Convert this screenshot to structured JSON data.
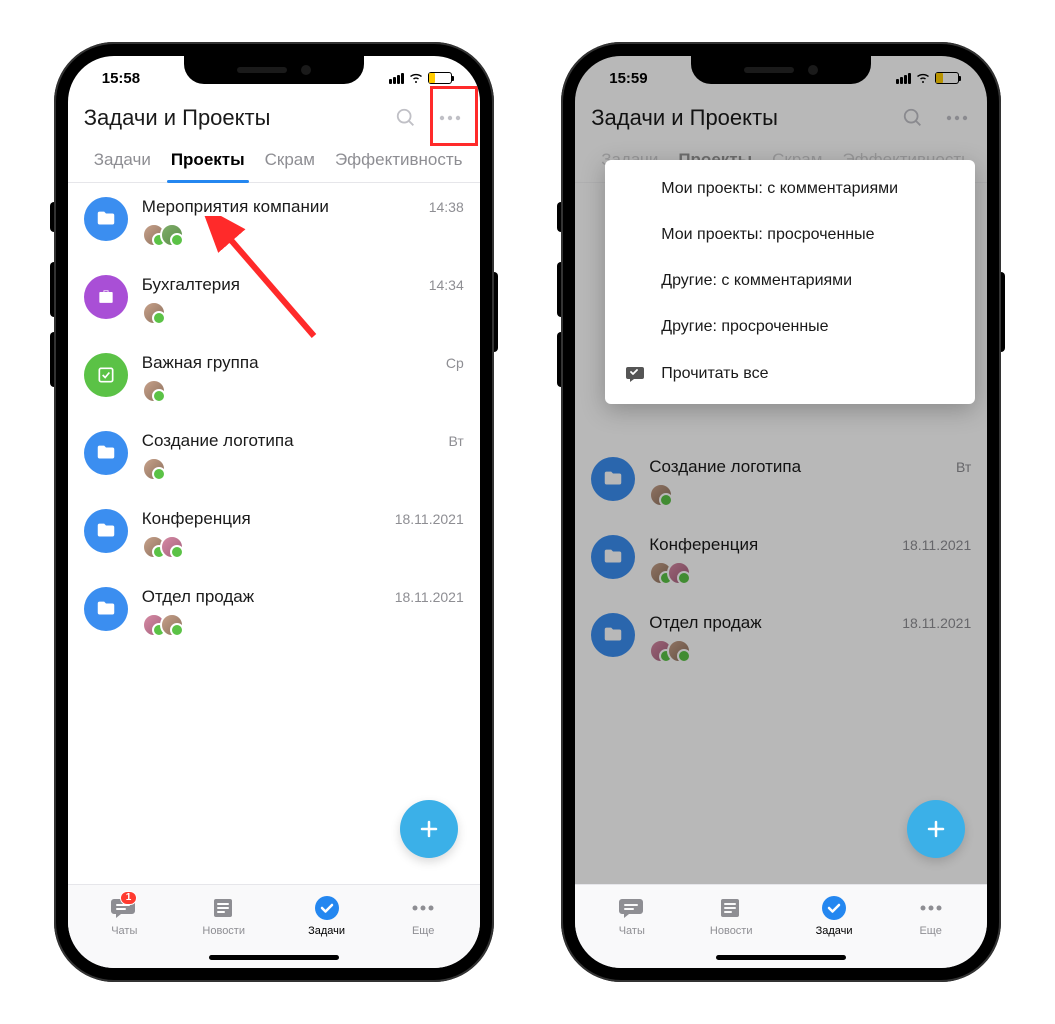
{
  "phone1": {
    "status_time": "15:58",
    "header_title": "Задачи и Проекты",
    "tabs": [
      "Задачи",
      "Проекты",
      "Скрам",
      "Эффективность"
    ],
    "active_tab_index": 1,
    "projects": [
      {
        "title": "Мероприятия компании",
        "time": "14:38",
        "icon": "folder",
        "color": "blue",
        "avatars": 2
      },
      {
        "title": "Бухгалтерия",
        "time": "14:34",
        "icon": "briefcase",
        "color": "purple",
        "avatars": 1
      },
      {
        "title": "Важная группа",
        "time": "Ср",
        "icon": "checkbox",
        "color": "green",
        "avatars": 1
      },
      {
        "title": "Создание логотипа",
        "time": "Вт",
        "icon": "folder",
        "color": "blue",
        "avatars": 1
      },
      {
        "title": "Конференция",
        "time": "18.11.2021",
        "icon": "folder",
        "color": "blue",
        "avatars": 2
      },
      {
        "title": "Отдел продаж",
        "time": "18.11.2021",
        "icon": "folder",
        "color": "blue",
        "avatars": 2
      }
    ],
    "nav": {
      "chats": "Чаты",
      "news": "Новости",
      "tasks": "Задачи",
      "more": "Еще",
      "badge": "1"
    }
  },
  "phone2": {
    "status_time": "15:59",
    "header_title": "Задачи и Проекты",
    "dropdown": {
      "items": [
        "Мои проекты: с комментариями",
        "Мои проекты: просроченные",
        "Другие: с комментариями",
        "Другие: просроченные"
      ],
      "read_all": "Прочитать все"
    },
    "projects_visible": [
      {
        "title": "Создание логотипа",
        "time": "Вт",
        "icon": "folder",
        "color": "blue",
        "avatars": 1
      },
      {
        "title": "Конференция",
        "time": "18.11.2021",
        "icon": "folder",
        "color": "blue",
        "avatars": 2
      },
      {
        "title": "Отдел продаж",
        "time": "18.11.2021",
        "icon": "folder",
        "color": "blue",
        "avatars": 2
      }
    ],
    "nav": {
      "chats": "Чаты",
      "news": "Новости",
      "tasks": "Задачи",
      "more": "Еще"
    }
  }
}
